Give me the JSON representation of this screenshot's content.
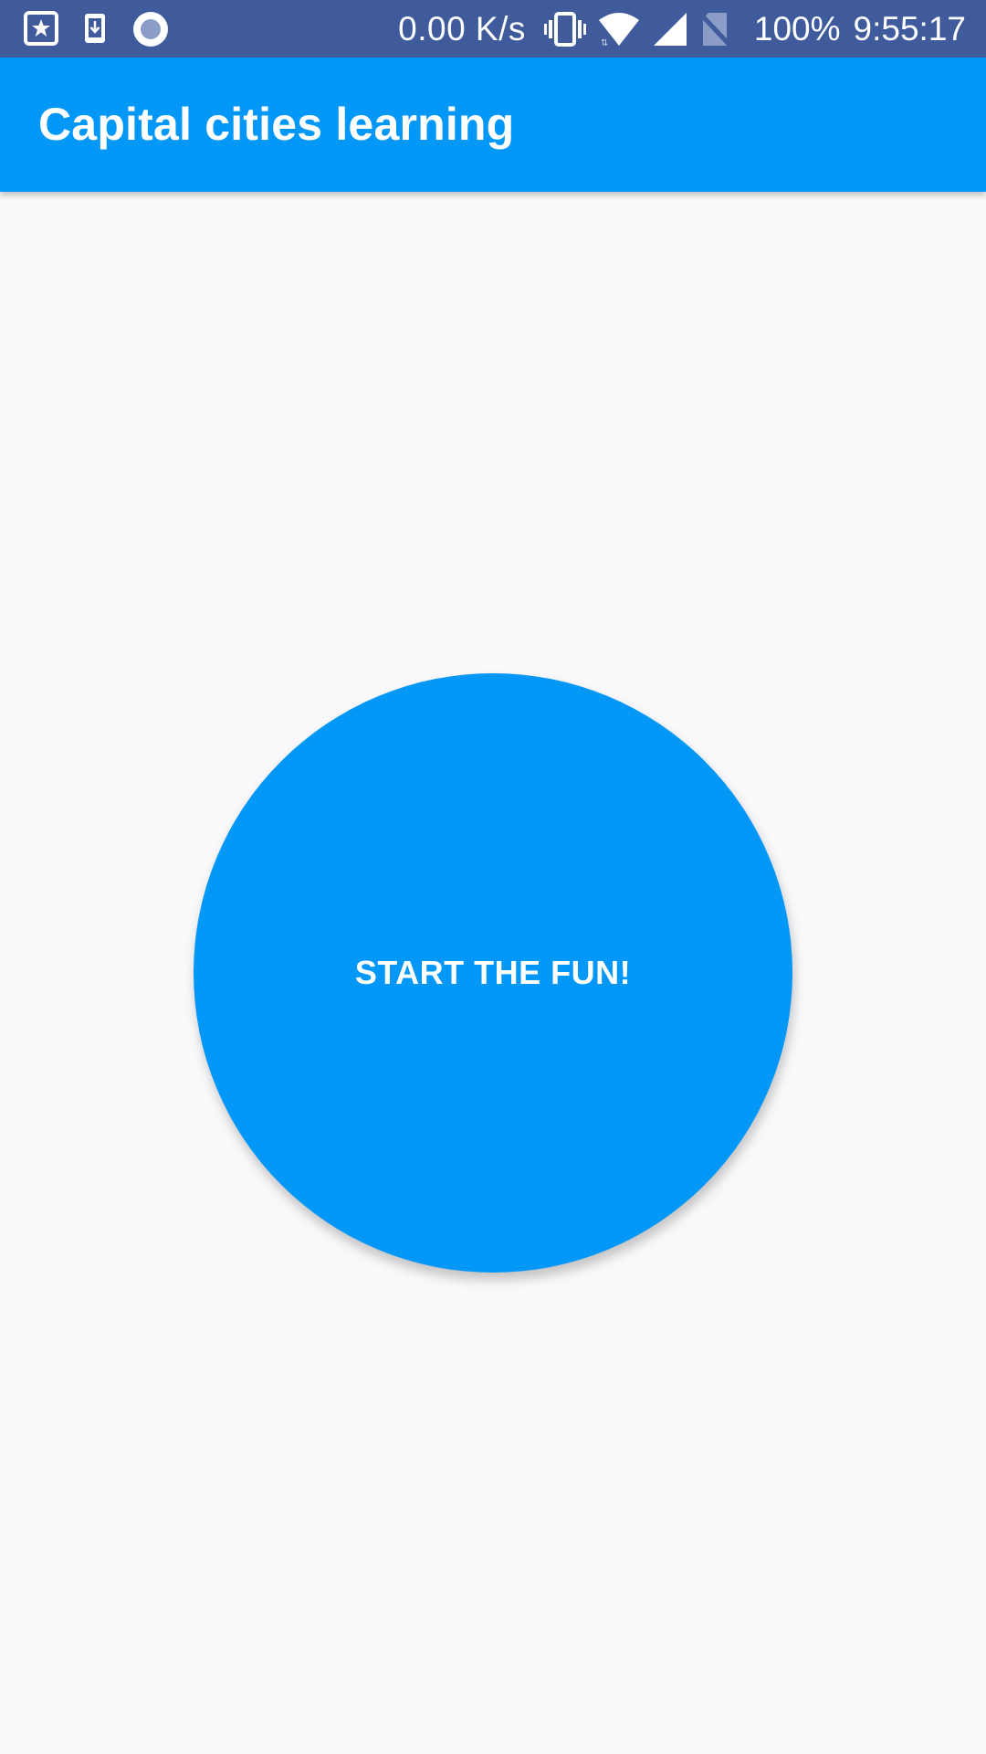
{
  "status_bar": {
    "left_icons": [
      "bookmark-star-icon",
      "download-icon",
      "record-icon"
    ],
    "net_speed": "0.00 K/s",
    "right_icons": [
      "vibrate-icon",
      "wifi-icon",
      "cell-signal-icon",
      "no-sim-icon"
    ],
    "battery": "100%",
    "time": "9:55:17",
    "background_color": "#3f5b9b"
  },
  "app_bar": {
    "title": "Capital cities learning",
    "background_color": "#0398f7"
  },
  "main": {
    "start_button_label": "START THE FUN!",
    "button_color": "#0398f7",
    "background_color": "#f9f9fb"
  }
}
